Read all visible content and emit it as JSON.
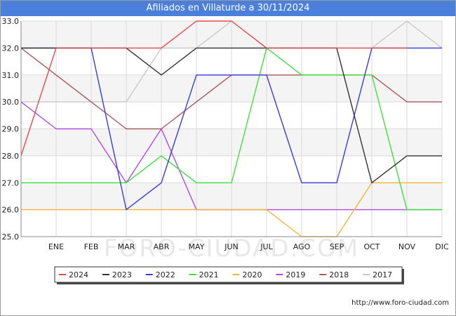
{
  "title": "Afiliados en Villaturde a 30/11/2024",
  "source": "http://www.foro-ciudad.com",
  "watermark": "FORO-CIUDAD.COM",
  "chart_data": {
    "type": "line",
    "categories": [
      "ENE",
      "FEB",
      "MAR",
      "ABR",
      "MAY",
      "JUN",
      "JUL",
      "AGO",
      "SEP",
      "OCT",
      "NOV",
      "DIC"
    ],
    "ylim": [
      25.0,
      33.0
    ],
    "yticks": [
      "25.0",
      "26.0",
      "27.0",
      "28.0",
      "29.0",
      "30.0",
      "31.0",
      "32.0",
      "33.0"
    ],
    "grid": true,
    "legend_position": "bottom",
    "series": [
      {
        "name": "2024",
        "color": "#e8494a",
        "values": [
          28,
          32,
          32,
          32,
          32,
          33,
          33,
          32,
          32,
          32,
          32,
          32,
          null
        ]
      },
      {
        "name": "2023",
        "color": "#333333",
        "values": [
          32,
          32,
          32,
          32,
          31,
          32,
          32,
          32,
          32,
          32,
          27,
          28,
          28
        ]
      },
      {
        "name": "2022",
        "color": "#3a3adf",
        "values": [
          32,
          32,
          32,
          26,
          27,
          31,
          31,
          31,
          27,
          27,
          32,
          32,
          32
        ]
      },
      {
        "name": "2021",
        "color": "#3be23b",
        "values": [
          27,
          27,
          27,
          27,
          28,
          27,
          27,
          32,
          31,
          31,
          31,
          26,
          26
        ]
      },
      {
        "name": "2020",
        "color": "#f5b437",
        "values": [
          26,
          26,
          26,
          26,
          26,
          26,
          26,
          26,
          25,
          25,
          27,
          27,
          27
        ]
      },
      {
        "name": "2019",
        "color": "#b04ae0",
        "values": [
          30,
          29,
          29,
          27,
          29,
          26,
          26,
          26,
          26,
          26,
          26,
          26,
          26
        ]
      },
      {
        "name": "2018",
        "color": "#a85a5a",
        "values": [
          32,
          31,
          30,
          29,
          29,
          30,
          31,
          31,
          31,
          31,
          31,
          30,
          30
        ]
      },
      {
        "name": "2017",
        "color": "#c9c9c9",
        "values": [
          30,
          30,
          30,
          30,
          32,
          32,
          33,
          32,
          32,
          32,
          32,
          33,
          32
        ]
      }
    ]
  }
}
